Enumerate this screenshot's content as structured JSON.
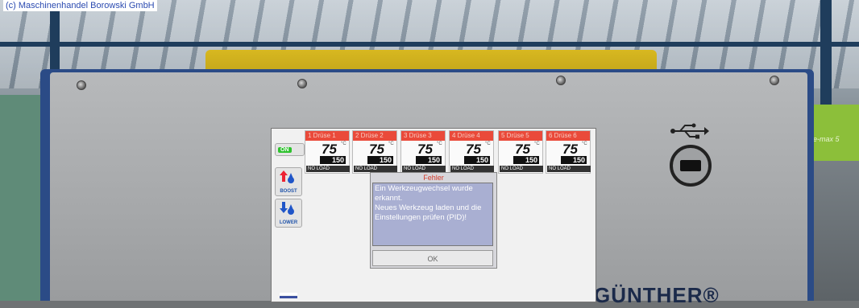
{
  "copyright": "(c) Maschinenhandel Borowski GmbH",
  "brand": "GÜNTHER®",
  "screen": {
    "on_button": "ON",
    "boost_label": "BOOST",
    "lower_label": "LOWER",
    "zones": [
      {
        "header": "1 Drüse 1",
        "actual": "75",
        "setpoint": "150",
        "status": "NO LOAD"
      },
      {
        "header": "2 Drüse 2",
        "actual": "75",
        "setpoint": "150",
        "status": "NO LOAD"
      },
      {
        "header": "3 Drüse 3",
        "actual": "75",
        "setpoint": "150",
        "status": "NO LOAD"
      },
      {
        "header": "4 Drüse 4",
        "actual": "75",
        "setpoint": "150",
        "status": "NO LOAD"
      },
      {
        "header": "5 Drüse 5",
        "actual": "75",
        "setpoint": "150",
        "status": "NO LOAD"
      },
      {
        "header": "6 Drüse 6",
        "actual": "75",
        "setpoint": "150",
        "status": "NO LOAD"
      }
    ],
    "dialog": {
      "title": "Fehler",
      "message_1": "Ein Werkzeugwechsel wurde",
      "message_2": "erkannt.",
      "message_3": "Neues Werkzeug laden und die",
      "message_4": "Einstellungen prüfen (PID)!",
      "ok_label": "OK"
    }
  },
  "right_sign": "e-max 5"
}
